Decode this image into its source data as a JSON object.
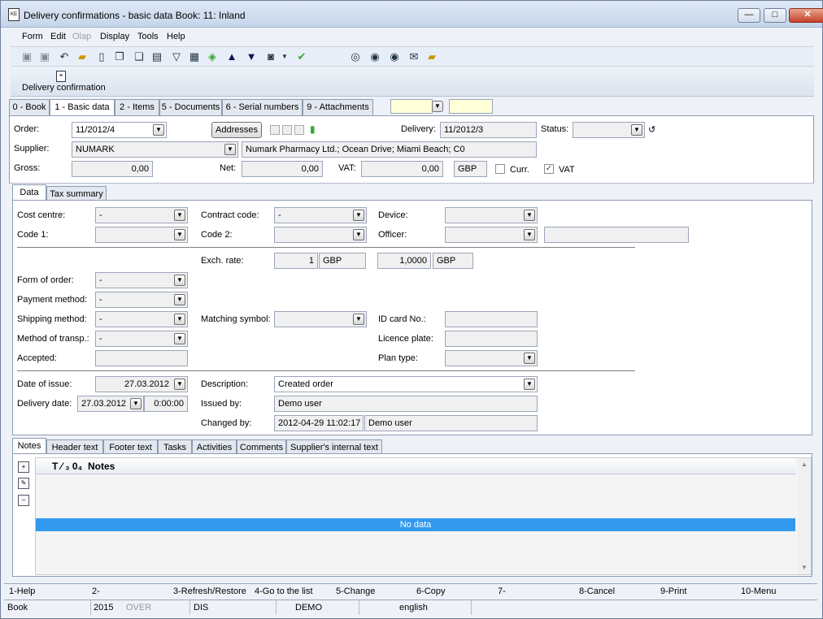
{
  "window": {
    "title": "Delivery confirmations - basic data    Book: 11: Inland",
    "minimize": "—",
    "maximize": "□",
    "close": "✕"
  },
  "menu": {
    "form": "Form",
    "edit": "Edit",
    "olap": "Olap",
    "display": "Display",
    "tools": "Tools",
    "help": "Help"
  },
  "ribbon": {
    "label": "Delivery confirmation"
  },
  "tabs": [
    "0 - Book",
    "1 - Basic data",
    "2 - Items",
    "5 - Documents",
    "6 - Serial numbers",
    "9 - Attachments"
  ],
  "header": {
    "order_label": "Order:",
    "order_value": "11/2012/4",
    "addresses_button": "Addresses",
    "delivery_label": "Delivery:",
    "delivery_value": "11/2012/3",
    "status_label": "Status:",
    "status_value": "",
    "supplier_label": "Supplier:",
    "supplier_value": "NUMARK",
    "supplier_address": "Numark Pharmacy Ltd.; Ocean Drive; Miami Beach; C0",
    "gross_label": "Gross:",
    "gross_value": "0,00",
    "net_label": "Net:",
    "net_value": "0,00",
    "vat_label": "VAT:",
    "vat_value": "0,00",
    "currency": "GBP",
    "curr_check_label": "Curr.",
    "vat_check_label": "VAT",
    "vat_checked": true,
    "curr_checked": false
  },
  "subtabs": [
    "Data",
    "Tax summary"
  ],
  "data": {
    "cost_centre_label": "Cost centre:",
    "cost_centre_value": "-",
    "contract_code_label": "Contract code:",
    "contract_code_value": "-",
    "device_label": "Device:",
    "device_value": "",
    "code1_label": "Code 1:",
    "code1_value": "",
    "code2_label": "Code 2:",
    "code2_value": "",
    "officer_label": "Officer:",
    "officer_value": "",
    "officer_name": "",
    "exch_rate_label": "Exch. rate:",
    "exch_rate_amount": "1",
    "exch_rate_cur1": "GBP",
    "exch_rate_rate": "1,0000",
    "exch_rate_cur2": "GBP",
    "form_of_order_label": "Form of order:",
    "form_of_order_value": "-",
    "payment_method_label": "Payment method:",
    "payment_method_value": "-",
    "shipping_method_label": "Shipping method:",
    "shipping_method_value": "-",
    "matching_symbol_label": "Matching symbol:",
    "matching_symbol_value": "",
    "id_card_label": "ID card No.:",
    "id_card_value": "",
    "method_transp_label": "Method of transp.:",
    "method_transp_value": "-",
    "licence_plate_label": "Licence plate:",
    "licence_plate_value": "",
    "accepted_label": "Accepted:",
    "accepted_value": "",
    "plan_type_label": "Plan type:",
    "plan_type_value": "",
    "date_issue_label": "Date of issue:",
    "date_issue_value": "27.03.2012",
    "description_label": "Description:",
    "description_value": "Created order",
    "delivery_date_label": "Delivery date:",
    "delivery_date_value": "27.03.2012",
    "delivery_time_value": "0:00:00",
    "issued_by_label": "Issued by:",
    "issued_by_value": "Demo user",
    "changed_by_label": "Changed by:",
    "changed_by_date": "2012-04-29 11:02:17",
    "changed_by_user": "Demo user"
  },
  "bottomtabs": [
    "Notes",
    "Header text",
    "Footer text",
    "Tasks",
    "Activities",
    "Comments",
    "Supplier's internal text"
  ],
  "notes": {
    "column_prefix": "T ⁄ ₃ 0₄",
    "column": "Notes",
    "empty": "No data"
  },
  "fkeys": [
    "1-Help",
    "2-",
    "3-Refresh/Restore",
    "4-Go to the list",
    "5-Change",
    "6-Copy",
    "7-",
    "8-Cancel",
    "9-Print",
    "10-Menu"
  ],
  "statusbar": {
    "book": "Book",
    "year": "2015",
    "over": "OVER",
    "dis": "DIS",
    "db": "DEMO",
    "lang": "english"
  }
}
